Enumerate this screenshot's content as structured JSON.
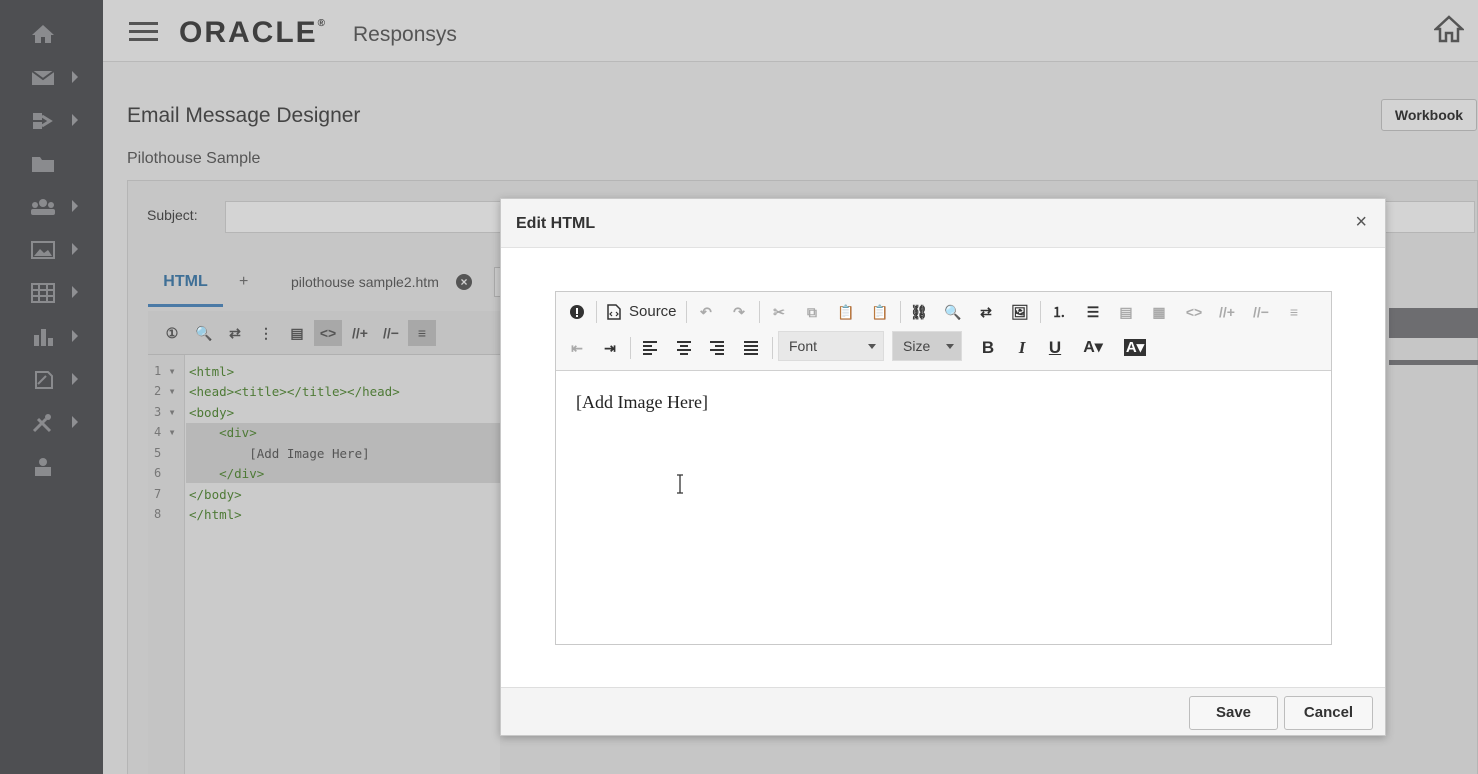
{
  "header": {
    "brand": "ORACLE",
    "brand_mark": "®",
    "product": "Responsys"
  },
  "nav": {
    "items": [
      {
        "icon": "home-icon",
        "has_submenu": false
      },
      {
        "icon": "mail-icon",
        "has_submenu": true
      },
      {
        "icon": "program-icon",
        "has_submenu": true
      },
      {
        "icon": "folder-icon",
        "has_submenu": false
      },
      {
        "icon": "audience-icon",
        "has_submenu": true
      },
      {
        "icon": "image-icon",
        "has_submenu": true
      },
      {
        "icon": "table-icon",
        "has_submenu": true
      },
      {
        "icon": "chart-icon",
        "has_submenu": true
      },
      {
        "icon": "document-icon",
        "has_submenu": true
      },
      {
        "icon": "tools-icon",
        "has_submenu": true
      },
      {
        "icon": "account-icon",
        "has_submenu": false
      }
    ]
  },
  "page": {
    "title": "Email Message Designer",
    "subtitle": "Pilothouse Sample",
    "workbook_label": "Workbook",
    "subject_label": "Subject:",
    "subject_value": "",
    "tabs": {
      "html": "HTML",
      "add": "+",
      "file": "pilothouse sample2.htm",
      "close": "×"
    },
    "code_toolbar": [
      "①",
      "🔍",
      "⇄",
      "⋮",
      "▤",
      "<>",
      "//+",
      "//−",
      "≡"
    ],
    "code": {
      "line_numbers": [
        "1 ▾",
        "2 ▾",
        "3 ▾",
        "4 ▾",
        "5",
        "6",
        "7",
        "8"
      ],
      "lines": [
        "<html>",
        "<head><title></title></head>",
        "<body>",
        "    <div>",
        "        [Add Image Here]",
        "    </div>",
        "</body>",
        "</html>"
      ]
    }
  },
  "dialog": {
    "title": "Edit HTML",
    "close": "×",
    "toolbar": {
      "source_label": "Source",
      "font_label": "Font",
      "size_label": "Size",
      "bold": "B",
      "italic": "I",
      "underline": "U",
      "text_color": "A▾",
      "bg_color": "A▾"
    },
    "content_text": "[Add Image Here]",
    "save_label": "Save",
    "cancel_label": "Cancel"
  },
  "colors": {
    "nav_bg": "#4e4f52",
    "accent_tab": "#3e6f96"
  }
}
